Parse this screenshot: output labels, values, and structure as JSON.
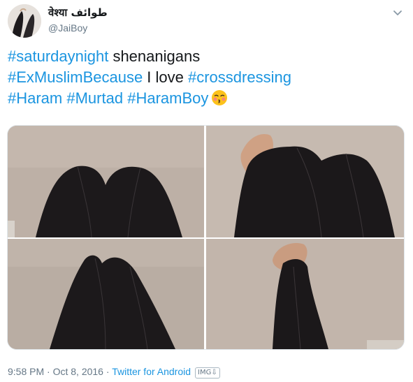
{
  "user": {
    "display_name": "वेश्या طوائف",
    "handle": "@JaiBoy"
  },
  "tweet": {
    "lines": [
      [
        {
          "text": "#saturdaynight",
          "type": "hashtag"
        },
        {
          "text": " shenanigans",
          "type": "text"
        }
      ],
      [
        {
          "text": "#ExMuslimBecause",
          "type": "hashtag"
        },
        {
          "text": " I love ",
          "type": "text"
        },
        {
          "text": "#crossdressing",
          "type": "hashtag"
        }
      ],
      [
        {
          "text": "#Haram",
          "type": "hashtag"
        },
        {
          "text": " ",
          "type": "text"
        },
        {
          "text": "#Murtad",
          "type": "hashtag"
        },
        {
          "text": " ",
          "type": "text"
        },
        {
          "text": "#HaramBoy",
          "type": "hashtag"
        }
      ]
    ],
    "emoji": "kissing-face-with-closed-eyes-emoji"
  },
  "media": {
    "count": 4,
    "description_icon": "photo-grid"
  },
  "meta": {
    "time": "9:58 PM",
    "separator": " · ",
    "date": "Oct 8, 2016",
    "source": "Twitter for Android",
    "badge": "IMG⇩"
  },
  "colors": {
    "link": "#1b95e0",
    "text": "#14171a",
    "secondary": "#657786",
    "wall": "#b9ada3",
    "leggings": "#1a1719"
  }
}
